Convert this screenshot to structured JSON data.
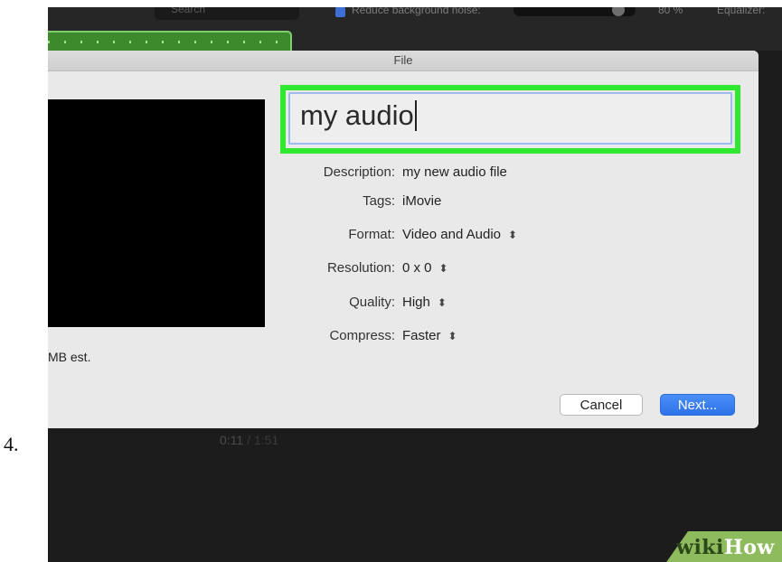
{
  "step_number": "4.",
  "background_app": {
    "search_placeholder": "Search",
    "reduce_noise_label": "Reduce background noise:",
    "noise_value": "80 %",
    "equalizer_label": "Equalizer:",
    "timecode_current": "0:11",
    "timecode_separator": "/",
    "timecode_total": "1:51"
  },
  "dialog": {
    "title": "File",
    "name_value": "my audio",
    "size_estimate": "MB est.",
    "fields": {
      "description": {
        "label": "Description:",
        "value": "my new audio file"
      },
      "tags": {
        "label": "Tags:",
        "value": "iMovie"
      },
      "format": {
        "label": "Format:",
        "value": "Video and Audio"
      },
      "resolution": {
        "label": "Resolution:",
        "value": "0 x 0"
      },
      "quality": {
        "label": "Quality:",
        "value": "High"
      },
      "compress": {
        "label": "Compress:",
        "value": "Faster"
      }
    },
    "cancel_label": "Cancel",
    "next_label": "Next..."
  },
  "watermark": {
    "part1": "wiki",
    "part2": "How"
  },
  "colors": {
    "highlight": "#2fe82f",
    "primary_button": "#2e72ea",
    "audio_track": "#3d8a2c"
  }
}
